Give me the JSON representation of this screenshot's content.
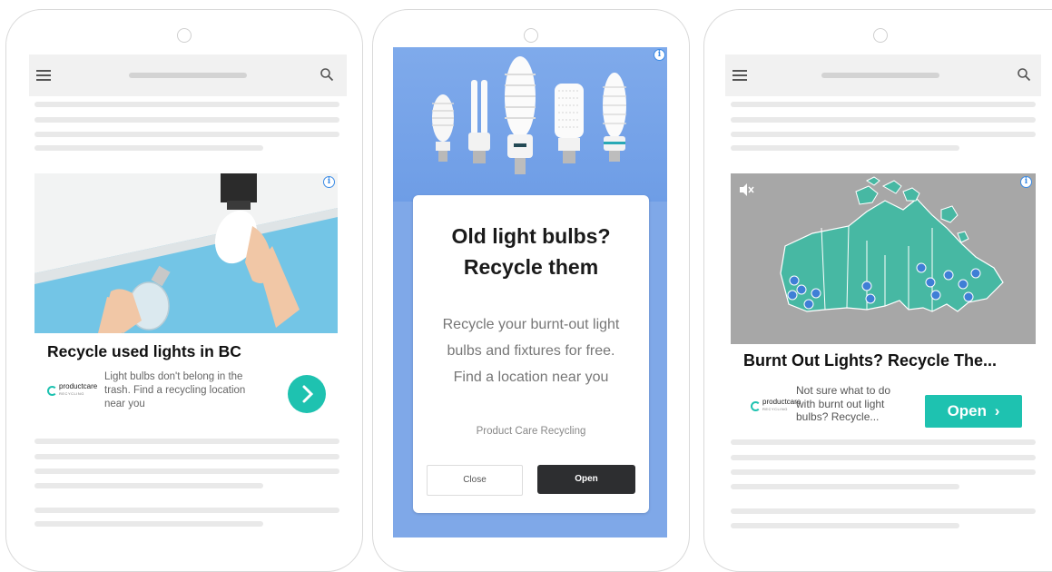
{
  "colors": {
    "accent": "#1ec2b0",
    "info_blue": "#3b8be5",
    "dark_button": "#2d2e30",
    "page_skeleton": "#e9e9e9",
    "map_land": "#47b8a3",
    "map_background": "#a7a7a7",
    "bulb_background": "#7fa8e8"
  },
  "icons": {
    "menu": "hamburger-menu-icon",
    "search": "magnifier-search-icon",
    "ad_info": "info-circle-icon",
    "next": "chevron-right-icon",
    "mute": "speaker-muted-icon",
    "location": "location-pin-icon"
  },
  "phone1": {
    "ad": {
      "info_glyph": "i",
      "title": "Recycle used lights in BC",
      "description": "Light bulbs don't belong in the trash. Find a recycling location near you",
      "advertiser_logo": {
        "name": "productcare",
        "tag": "RECYCLING"
      }
    }
  },
  "phone2": {
    "ad": {
      "info_glyph": "i",
      "title_line1": "Old light bulbs?",
      "title_line2": "Recycle them",
      "description": "Recycle your burnt-out light bulbs and fixtures for free. Find a location near you",
      "advertiser": "Product Care Recycling",
      "close_label": "Close",
      "open_label": "Open"
    }
  },
  "phone3": {
    "ad": {
      "info_glyph": "i",
      "title": "Burnt Out Lights? Recycle The...",
      "description": "Not sure what to do with burnt out light bulbs? Recycle...",
      "open_label": "Open",
      "open_arrow": "›",
      "advertiser_logo": {
        "name": "productcare",
        "tag": "RECYCLING"
      }
    }
  }
}
